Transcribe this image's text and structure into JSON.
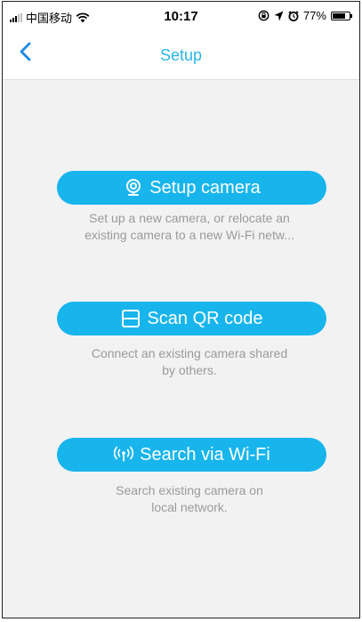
{
  "status_bar": {
    "carrier": "中国移动",
    "time": "10:17",
    "battery": "77%",
    "battery_level": 0.77,
    "icons": [
      "signal-icon",
      "wifi-icon",
      "lock-rotation-icon",
      "location-icon",
      "alarm-icon",
      "battery-icon"
    ]
  },
  "nav": {
    "title": "Setup",
    "back_icon": "chevron-left-icon"
  },
  "options": [
    {
      "label": "Setup camera",
      "icon": "camera-icon",
      "description_line1": "Set up a new camera, or relocate an",
      "description_line2": "existing camera to a new Wi-Fi netw..."
    },
    {
      "label": "Scan QR code",
      "icon": "qr-scan-icon",
      "description_line1": "Connect an existing camera shared",
      "description_line2": "by others."
    },
    {
      "label": "Search via Wi-Fi",
      "icon": "wifi-antenna-icon",
      "description_line1": "Search existing camera on",
      "description_line2": "local network."
    }
  ],
  "colors": {
    "accent": "#17b5ec",
    "title": "#29b6e8",
    "background": "#f2f2f2",
    "description": "#9a9a9a"
  }
}
